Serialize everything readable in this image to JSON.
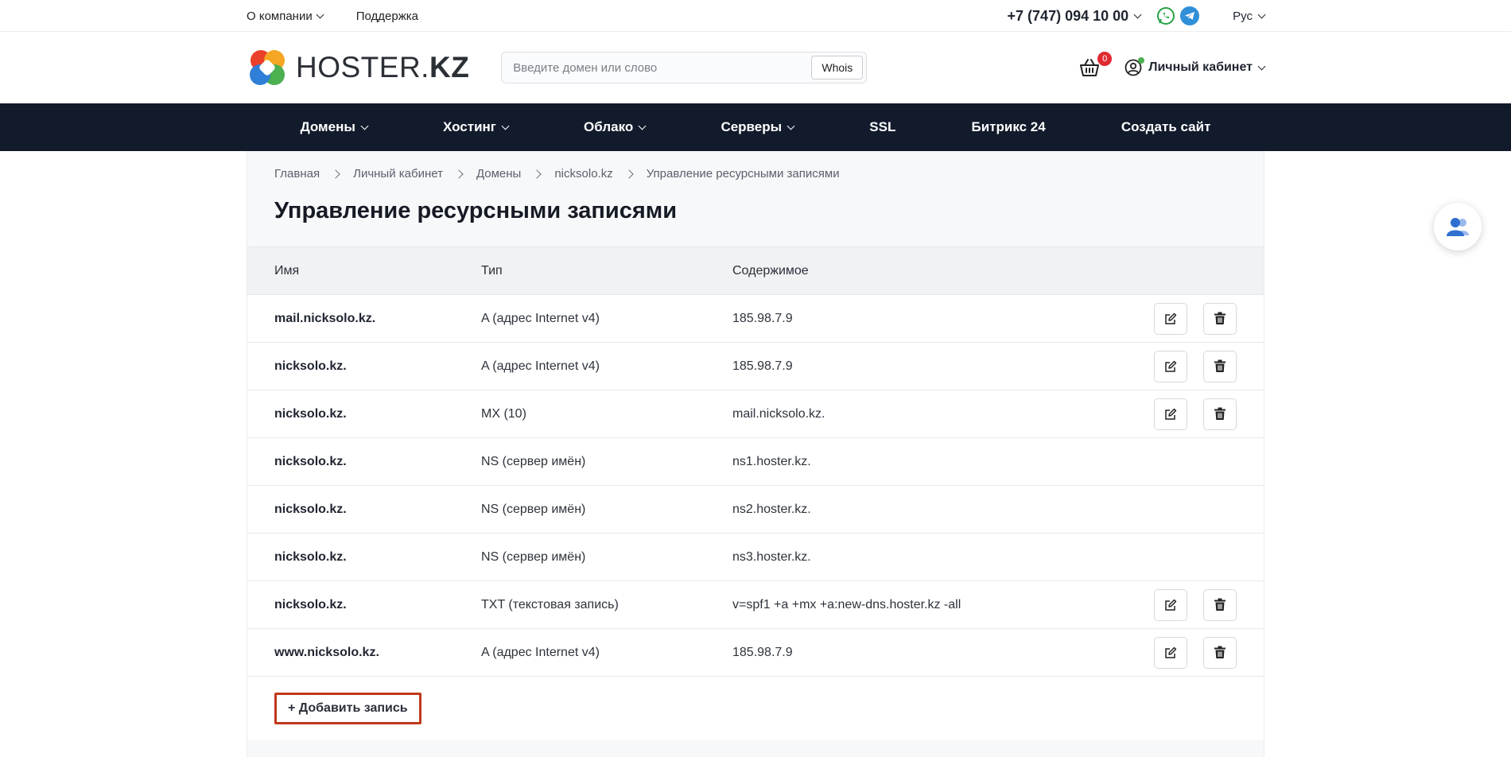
{
  "topbar": {
    "about": "О компании",
    "support": "Поддержка",
    "phone": "+7 (747) 094 10 00",
    "language": "Рус"
  },
  "header": {
    "logo_main": "HOSTER.",
    "logo_suffix": "KZ",
    "search_placeholder": "Введите домен или слово",
    "whois_label": "Whois",
    "cart_count": "0",
    "cabinet_label": "Личный кабинет"
  },
  "nav": {
    "items": [
      {
        "label": "Домены"
      },
      {
        "label": "Хостинг"
      },
      {
        "label": "Облако"
      },
      {
        "label": "Серверы"
      },
      {
        "label": "SSL"
      },
      {
        "label": "Битрикс 24"
      },
      {
        "label": "Создать сайт"
      }
    ]
  },
  "breadcrumb": [
    "Главная",
    "Личный кабинет",
    "Домены",
    "nicksolo.kz",
    "Управление ресурсными записями"
  ],
  "page": {
    "title": "Управление ресурсными записями"
  },
  "table": {
    "headers": {
      "name": "Имя",
      "type": "Тип",
      "content": "Содержимое"
    },
    "rows": [
      {
        "name": "mail.nicksolo.kz.",
        "type": "A (адрес Internet v4)",
        "content": "185.98.7.9",
        "editable": true
      },
      {
        "name": "nicksolo.kz.",
        "type": "A (адрес Internet v4)",
        "content": "185.98.7.9",
        "editable": true
      },
      {
        "name": "nicksolo.kz.",
        "type": "MX (10)",
        "content": "mail.nicksolo.kz.",
        "editable": true
      },
      {
        "name": "nicksolo.kz.",
        "type": "NS (сервер имён)",
        "content": "ns1.hoster.kz.",
        "editable": false
      },
      {
        "name": "nicksolo.kz.",
        "type": "NS (сервер имён)",
        "content": "ns2.hoster.kz.",
        "editable": false
      },
      {
        "name": "nicksolo.kz.",
        "type": "NS (сервер имён)",
        "content": "ns3.hoster.kz.",
        "editable": false
      },
      {
        "name": "nicksolo.kz.",
        "type": "TXT (текстовая запись)",
        "content": "v=spf1 +a +mx +a:new-dns.hoster.kz -all",
        "editable": true
      },
      {
        "name": "www.nicksolo.kz.",
        "type": "A (адрес Internet v4)",
        "content": "185.98.7.9",
        "editable": true
      }
    ],
    "add_label": "+ Добавить запись"
  },
  "colors": {
    "nav_bg": "#121b2b",
    "badge": "#e02a32",
    "add_border": "#c0381b",
    "whatsapp": "#25a244",
    "telegram": "#2f8fd8"
  }
}
